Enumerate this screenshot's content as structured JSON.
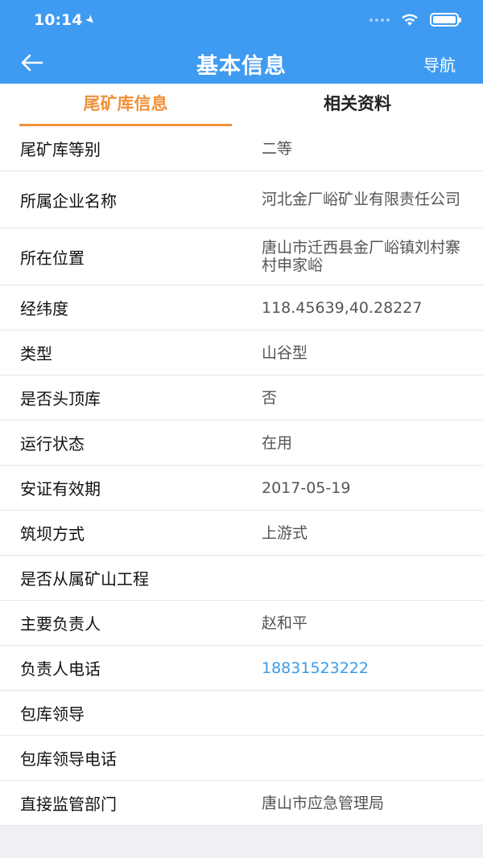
{
  "status_bar": {
    "time": "10:14"
  },
  "nav": {
    "title": "基本信息",
    "right_label": "导航"
  },
  "tabs": [
    {
      "label": "尾矿库信息",
      "active": true
    },
    {
      "label": "相关资料",
      "active": false
    }
  ],
  "rows": [
    {
      "label": "尾矿库等别",
      "value": "二等"
    },
    {
      "label": "所属企业名称",
      "value": "河北金厂峪矿业有限责任公司"
    },
    {
      "label": "所在位置",
      "value": "唐山市迁西县金厂峪镇刘村寨村申家峪"
    },
    {
      "label": "经纬度",
      "value": "118.45639,40.28227"
    },
    {
      "label": "类型",
      "value": "山谷型"
    },
    {
      "label": "是否头顶库",
      "value": "否"
    },
    {
      "label": "运行状态",
      "value": "在用"
    },
    {
      "label": "安证有效期",
      "value": "2017-05-19"
    },
    {
      "label": "筑坝方式",
      "value": "上游式"
    },
    {
      "label": "是否从属矿山工程",
      "value": ""
    },
    {
      "label": "主要负责人",
      "value": "赵和平"
    },
    {
      "label": "负责人电话",
      "value": "18831523222"
    },
    {
      "label": "包库领导",
      "value": ""
    },
    {
      "label": "包库领导电话",
      "value": ""
    },
    {
      "label": "直接监管部门",
      "value": "唐山市应急管理局"
    }
  ],
  "colors": {
    "header": "#3f9bf2",
    "active_tab": "#f0913a",
    "link": "#3a9be8"
  }
}
